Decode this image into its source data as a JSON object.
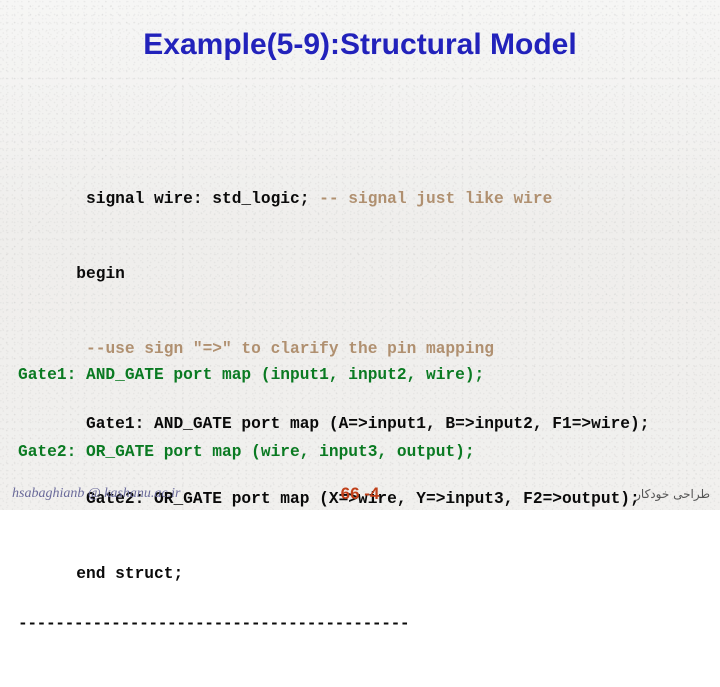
{
  "slide": {
    "title": "Example(5-9):Structural Model",
    "background_color": "#f1f0ee",
    "title_color": "#2222bb"
  },
  "code": {
    "comment_color": "#b09070",
    "text_color": "#0a0a0a",
    "green_color": "#0a7a22",
    "lines": [
      {
        "id": "line-signal",
        "segments": [
          {
            "text": " signal wire: std_logic; ",
            "style": "black"
          },
          {
            "text": "-- signal just like wire",
            "style": "comment"
          }
        ]
      },
      {
        "id": "line-begin",
        "segments": [
          {
            "text": "begin",
            "style": "black"
          }
        ]
      },
      {
        "id": "line-use-sign-comment",
        "segments": [
          {
            "text": " --use sign \"=>\" to clarify the pin mapping",
            "style": "comment"
          }
        ]
      },
      {
        "id": "line-gate1-named",
        "segments": [
          {
            "text": " Gate1: AND_GATE port map (A=>input1, B=>input2, F1=>wire);",
            "style": "black"
          }
        ]
      },
      {
        "id": "line-gate2-named",
        "segments": [
          {
            "text": " Gate2: OR_GATE port map (X=>wire, Y=>input3, F2=>output);",
            "style": "black"
          }
        ]
      },
      {
        "id": "line-end-struct",
        "segments": [
          {
            "text": "end struct;",
            "style": "black"
          }
        ]
      }
    ],
    "separator": "------------------------------------------",
    "positional_lines": [
      {
        "id": "line-gate1-positional",
        "text": "Gate1: AND_GATE port map (input1, input2, wire);"
      },
      {
        "id": "line-gate2-positional",
        "text": "Gate2: OR_GATE port map (wire, input3, output);"
      }
    ]
  },
  "footer": {
    "email": "hsabaghianb @ kashanu.ac.ir",
    "page_number": "66 -4",
    "page_number_color": "#c0401a",
    "right_label": "طراحی خودکار"
  }
}
